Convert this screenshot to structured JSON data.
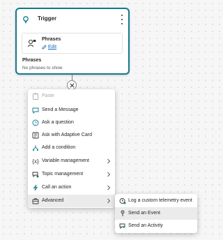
{
  "trigger": {
    "title": "Trigger",
    "phrases_box": {
      "title": "Phrases",
      "edit_label": "Edit"
    },
    "phrases_label": "Phrases",
    "phrases_empty": "No phrases to show"
  },
  "menu": {
    "items": [
      {
        "label": "Paste",
        "icon": "paste-icon",
        "disabled": true
      },
      {
        "label": "Send a Message",
        "icon": "message-icon"
      },
      {
        "label": "Ask a question",
        "icon": "question-icon"
      },
      {
        "label": "Ask with Adaptive Card",
        "icon": "adaptive-card-icon"
      },
      {
        "label": "Add a condition",
        "icon": "branch-icon"
      },
      {
        "label": "Variable management",
        "icon": "variable-icon",
        "submenu": true
      },
      {
        "label": "Topic management",
        "icon": "topic-icon",
        "submenu": true
      },
      {
        "label": "Call an action",
        "icon": "action-icon",
        "submenu": true
      },
      {
        "label": "Advanced",
        "icon": "toolbox-icon",
        "submenu": true,
        "active": true
      }
    ]
  },
  "submenu": {
    "items": [
      {
        "label": "Log a custom telemetry event",
        "icon": "telemetry-icon"
      },
      {
        "label": "Send an Event",
        "icon": "event-icon",
        "active": true
      },
      {
        "label": "Send an Activity",
        "icon": "activity-icon"
      }
    ]
  },
  "colors": {
    "accent": "#127a8c",
    "link": "#0f6cbd",
    "hover": "#ebebeb"
  }
}
